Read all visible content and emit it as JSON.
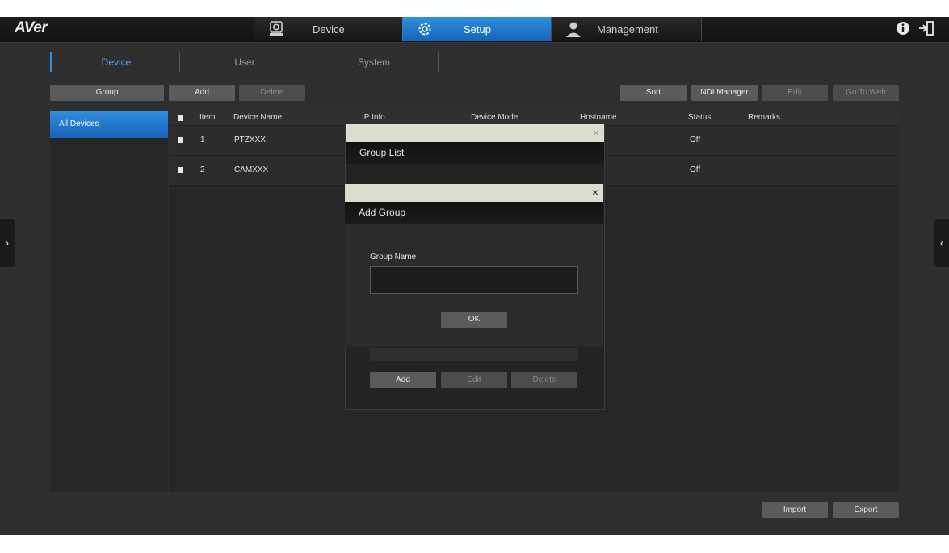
{
  "brand": "AVer",
  "main_tabs": [
    {
      "label": "Device",
      "icon": "camera-icon"
    },
    {
      "label": "Setup",
      "icon": "gear-icon"
    },
    {
      "label": "Management",
      "icon": "user-icon"
    }
  ],
  "top_icons": [
    "info-icon",
    "logout-icon"
  ],
  "sub_tabs": [
    "Device",
    "User",
    "System"
  ],
  "toolbar": {
    "group": "Group",
    "add": "Add",
    "delete": "Delete",
    "sort": "Sort",
    "ndi_manager": "NDI Manager",
    "edit": "Edit",
    "go_to_web": "Go To Web"
  },
  "left_panel": {
    "selected": "All Devices"
  },
  "table": {
    "headers": [
      "Item",
      "Device Name",
      "IP Info.",
      "Device Model",
      "Hostname",
      "Status",
      "Remarks"
    ],
    "rows": [
      {
        "item": "1",
        "name": "PTZXXX",
        "status": "Off"
      },
      {
        "item": "2",
        "name": "CAMXXX",
        "status": "Off"
      }
    ]
  },
  "group_list_dialog": {
    "title": "Group List",
    "add": "Add",
    "edit": "Edit",
    "delete": "Delete",
    "close": "×"
  },
  "add_group_dialog": {
    "title": "Add Group",
    "field_label": "Group Name",
    "field_value": "",
    "ok": "OK",
    "close": "×"
  },
  "footer": {
    "import": "Import",
    "export": "Export"
  },
  "side_arrows": {
    "left": "›",
    "right": "‹"
  },
  "colors": {
    "accent": "#1f7ad6",
    "background": "#2e2e2e"
  }
}
